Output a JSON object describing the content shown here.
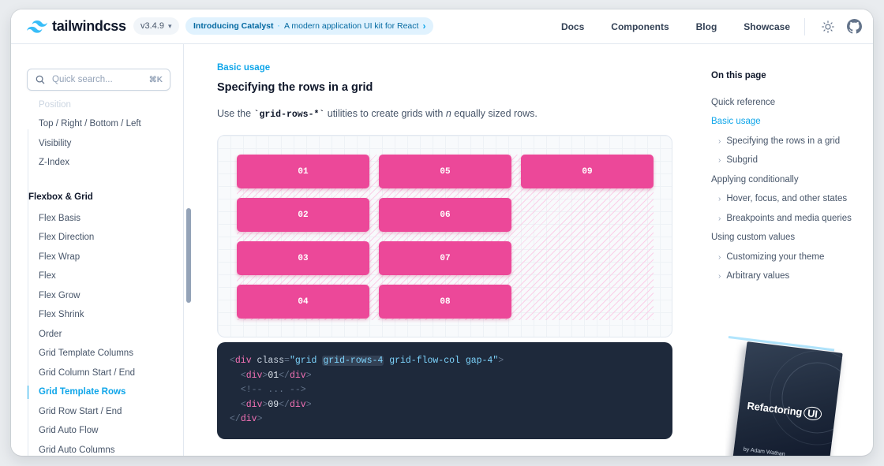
{
  "header": {
    "brand": "tailwindcss",
    "version": "v3.4.9",
    "announcement_title": "Introducing Catalyst",
    "announcement_sep": "·",
    "announcement_desc": "A modern application UI kit for React",
    "nav": [
      "Docs",
      "Components",
      "Blog",
      "Showcase"
    ]
  },
  "sidebar": {
    "search_placeholder": "Quick search...",
    "search_shortcut": "⌘K",
    "items_top": [
      "Position",
      "Top / Right / Bottom / Left",
      "Visibility",
      "Z-Index"
    ],
    "section_heading": "Flexbox & Grid",
    "items": [
      "Flex Basis",
      "Flex Direction",
      "Flex Wrap",
      "Flex",
      "Flex Grow",
      "Flex Shrink",
      "Order",
      "Grid Template Columns",
      "Grid Column Start / End",
      "Grid Template Rows",
      "Grid Row Start / End",
      "Grid Auto Flow",
      "Grid Auto Columns"
    ],
    "active_item": "Grid Template Rows"
  },
  "main": {
    "eyebrow": "Basic usage",
    "heading": "Specifying the rows in a grid",
    "para_before": "Use the ",
    "para_code": "`grid-rows-*`",
    "para_mid": " utilities to create grids with ",
    "para_em": "n",
    "para_after": " equally sized rows.",
    "cells": [
      "01",
      "02",
      "03",
      "04",
      "05",
      "06",
      "07",
      "08",
      "09"
    ],
    "code_lines": {
      "l1_open": "<",
      "l1_tag": "div",
      "l1_attr": " class",
      "l1_eq": "=",
      "l1_q1": "\"grid ",
      "l1_hl": "grid-rows-4",
      "l1_rest": " grid-flow-col gap-4\"",
      "l1_close": ">",
      "l2": "01",
      "l3": "<!-- ... -->",
      "l4": "09",
      "tag": "div"
    }
  },
  "toc": {
    "title": "On this page",
    "items": [
      {
        "label": "Quick reference",
        "level": 1
      },
      {
        "label": "Basic usage",
        "level": 1,
        "active": true
      },
      {
        "label": "Specifying the rows in a grid",
        "level": 2
      },
      {
        "label": "Subgrid",
        "level": 2
      },
      {
        "label": "Applying conditionally",
        "level": 1
      },
      {
        "label": "Hover, focus, and other states",
        "level": 2
      },
      {
        "label": "Breakpoints and media queries",
        "level": 2
      },
      {
        "label": "Using custom values",
        "level": 1
      },
      {
        "label": "Customizing your theme",
        "level": 2
      },
      {
        "label": "Arbitrary values",
        "level": 2
      }
    ]
  },
  "ad": {
    "book_title": "Refactoring",
    "book_title_ui": "UI",
    "book_by": "by Adam Wathan"
  },
  "colors": {
    "accent": "#0ea5e9",
    "cell": "#ec4899",
    "code_bg": "#1e293b"
  }
}
